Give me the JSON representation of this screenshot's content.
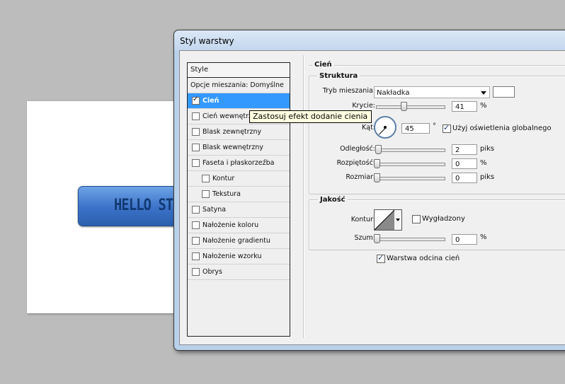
{
  "canvas": {
    "button_text": "HELLO ST"
  },
  "dialog": {
    "title": "Styl warstwy",
    "style_list": {
      "header": "Style",
      "blending_options": "Opcje mieszania: Domyślne",
      "items": [
        {
          "label": "Cień",
          "checked": true,
          "selected": true,
          "indent": false
        },
        {
          "label": "Cień wewnętrzny",
          "checked": false,
          "selected": false,
          "indent": false
        },
        {
          "label": "Blask zewnętrzny",
          "checked": false,
          "selected": false,
          "indent": false
        },
        {
          "label": "Blask wewnętrzny",
          "checked": false,
          "selected": false,
          "indent": false
        },
        {
          "label": "Faseta i płaskorzeźba",
          "checked": false,
          "selected": false,
          "indent": false
        },
        {
          "label": "Kontur",
          "checked": false,
          "selected": false,
          "indent": true
        },
        {
          "label": "Tekstura",
          "checked": false,
          "selected": false,
          "indent": true
        },
        {
          "label": "Satyna",
          "checked": false,
          "selected": false,
          "indent": false
        },
        {
          "label": "Nałożenie koloru",
          "checked": false,
          "selected": false,
          "indent": false
        },
        {
          "label": "Nałożenie gradientu",
          "checked": false,
          "selected": false,
          "indent": false
        },
        {
          "label": "Nałożenie wzorku",
          "checked": false,
          "selected": false,
          "indent": false
        },
        {
          "label": "Obrys",
          "checked": false,
          "selected": false,
          "indent": false
        }
      ]
    },
    "tooltip": "Zastosuj efekt dodanie cienia",
    "shadow": {
      "section_title": "Cień",
      "structure": {
        "title": "Struktura",
        "blend_mode_label": "Tryb mieszania:",
        "blend_mode_value": "Nakładka",
        "opacity_label": "Krycie:",
        "opacity_value": "41",
        "opacity_unit": "%",
        "opacity_level": 0.41,
        "angle_label": "Kąt:",
        "angle_value": "45",
        "angle_unit": "°",
        "global_light_label": "Użyj oświetlenia globalnego",
        "global_light_checked": true,
        "distance_label": "Odległość:",
        "distance_value": "2",
        "distance_unit": "piks",
        "spread_label": "Rozpiętość:",
        "spread_value": "0",
        "spread_unit": "%",
        "size_label": "Rozmiar:",
        "size_value": "0",
        "size_unit": "piks"
      },
      "quality": {
        "title": "Jakość",
        "contour_label": "Kontur:",
        "antialiased_label": "Wygładzony",
        "antialiased_checked": false,
        "noise_label": "Szum:",
        "noise_value": "0",
        "noise_unit": "%"
      },
      "knockout_label": "Warstwa odcina cień",
      "knockout_checked": true
    }
  }
}
